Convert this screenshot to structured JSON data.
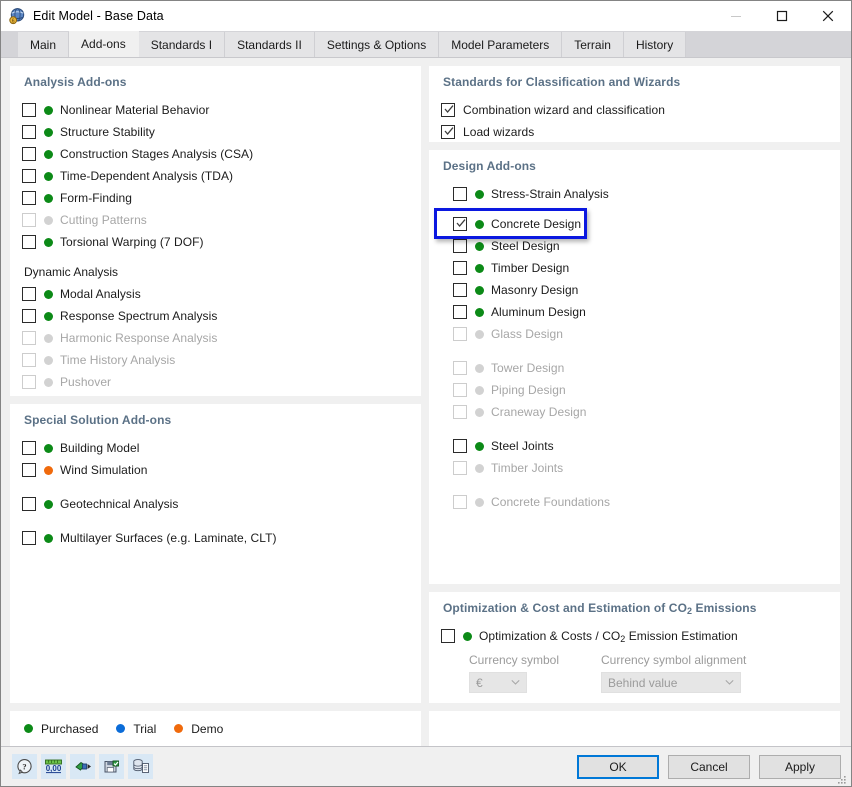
{
  "window": {
    "title": "Edit Model - Base Data",
    "icon": "model-globe-icon",
    "controls": {
      "minimize": "minimize-icon",
      "maximize": "maximize-icon",
      "close": "close-icon"
    }
  },
  "tabs": [
    {
      "label": "Main",
      "active": false
    },
    {
      "label": "Add-ons",
      "active": true
    },
    {
      "label": "Standards I",
      "active": false
    },
    {
      "label": "Standards II",
      "active": false
    },
    {
      "label": "Settings & Options",
      "active": false
    },
    {
      "label": "Model Parameters",
      "active": false
    },
    {
      "label": "Terrain",
      "active": false
    },
    {
      "label": "History",
      "active": false
    }
  ],
  "left": {
    "analysis": {
      "title": "Analysis Add-ons",
      "items": [
        {
          "label": "Nonlinear Material Behavior",
          "checked": false,
          "status": "green",
          "enabled": true
        },
        {
          "label": "Structure Stability",
          "checked": false,
          "status": "green",
          "enabled": true
        },
        {
          "label": "Construction Stages Analysis (CSA)",
          "checked": false,
          "status": "green",
          "enabled": true
        },
        {
          "label": "Time-Dependent Analysis (TDA)",
          "checked": false,
          "status": "green",
          "enabled": true
        },
        {
          "label": "Form-Finding",
          "checked": false,
          "status": "green",
          "enabled": true
        },
        {
          "label": "Cutting Patterns",
          "checked": false,
          "status": "gray",
          "enabled": false
        },
        {
          "label": "Torsional Warping (7 DOF)",
          "checked": false,
          "status": "green",
          "enabled": true
        }
      ],
      "dynamic_title": "Dynamic Analysis",
      "dynamic_items": [
        {
          "label": "Modal Analysis",
          "checked": false,
          "status": "green",
          "enabled": true
        },
        {
          "label": "Response Spectrum Analysis",
          "checked": false,
          "status": "green",
          "enabled": true
        },
        {
          "label": "Harmonic Response Analysis",
          "checked": false,
          "status": "gray",
          "enabled": false
        },
        {
          "label": "Time History Analysis",
          "checked": false,
          "status": "gray",
          "enabled": false
        },
        {
          "label": "Pushover",
          "checked": false,
          "status": "gray",
          "enabled": false
        }
      ]
    },
    "special": {
      "title": "Special Solution Add-ons",
      "items": [
        {
          "label": "Building Model",
          "checked": false,
          "status": "green",
          "enabled": true
        },
        {
          "label": "Wind Simulation",
          "checked": false,
          "status": "orange",
          "enabled": true
        },
        {
          "label": "Geotechnical Analysis",
          "checked": false,
          "status": "green",
          "enabled": true
        },
        {
          "label": "Multilayer Surfaces (e.g. Laminate, CLT)",
          "checked": false,
          "status": "green",
          "enabled": true
        }
      ]
    },
    "legend": [
      {
        "label": "Purchased",
        "color": "green"
      },
      {
        "label": "Trial",
        "color": "blue"
      },
      {
        "label": "Demo",
        "color": "orange"
      }
    ]
  },
  "right": {
    "standards": {
      "title": "Standards for Classification and Wizards",
      "items": [
        {
          "label": "Combination wizard and classification",
          "checked": true,
          "enabled": true
        },
        {
          "label": "Load wizards",
          "checked": true,
          "enabled": true
        }
      ]
    },
    "design": {
      "title": "Design Add-ons",
      "items": [
        {
          "label": "Stress-Strain Analysis",
          "checked": false,
          "status": "green",
          "enabled": true
        },
        {
          "label": "Concrete Design",
          "checked": true,
          "status": "green",
          "enabled": true,
          "highlighted": true
        },
        {
          "label": "Steel Design",
          "checked": false,
          "status": "green",
          "enabled": true
        },
        {
          "label": "Timber Design",
          "checked": false,
          "status": "green",
          "enabled": true
        },
        {
          "label": "Masonry Design",
          "checked": false,
          "status": "green",
          "enabled": true
        },
        {
          "label": "Aluminum Design",
          "checked": false,
          "status": "green",
          "enabled": true
        },
        {
          "label": "Glass Design",
          "checked": false,
          "status": "gray",
          "enabled": false
        },
        {
          "label": "Tower Design",
          "checked": false,
          "status": "gray",
          "enabled": false
        },
        {
          "label": "Piping Design",
          "checked": false,
          "status": "gray",
          "enabled": false
        },
        {
          "label": "Craneway Design",
          "checked": false,
          "status": "gray",
          "enabled": false
        },
        {
          "label": "Steel Joints",
          "checked": false,
          "status": "green",
          "enabled": true
        },
        {
          "label": "Timber Joints",
          "checked": false,
          "status": "gray",
          "enabled": false
        },
        {
          "label": "Concrete Foundations",
          "checked": false,
          "status": "gray",
          "enabled": false
        }
      ]
    },
    "optimization": {
      "title_pre": "Optimization & Cost and Estimation of CO",
      "title_sub": "2",
      "title_post": " Emissions",
      "item_pre": "Optimization & Costs / CO",
      "item_sub": "2",
      "item_post": " Emission Estimation",
      "checked": false,
      "status": "green",
      "currency_label": "Currency symbol",
      "currency_value": "€",
      "alignment_label": "Currency symbol alignment",
      "alignment_value": "Behind value"
    }
  },
  "footer": {
    "tools": [
      {
        "name": "help-icon"
      },
      {
        "name": "units-icon",
        "label": "0,00"
      },
      {
        "name": "import-icon"
      },
      {
        "name": "save-defaults-icon"
      },
      {
        "name": "database-report-icon"
      }
    ],
    "buttons": [
      {
        "label": "OK",
        "primary": true
      },
      {
        "label": "Cancel",
        "primary": false
      },
      {
        "label": "Apply",
        "primary": false
      }
    ]
  },
  "colors": {
    "accent": "#0078d7",
    "highlight": "#0b18e0",
    "purchased": "#0c8a17",
    "trial": "#0b6cd8",
    "demo": "#f06a0c",
    "section_title": "#5b7186"
  }
}
